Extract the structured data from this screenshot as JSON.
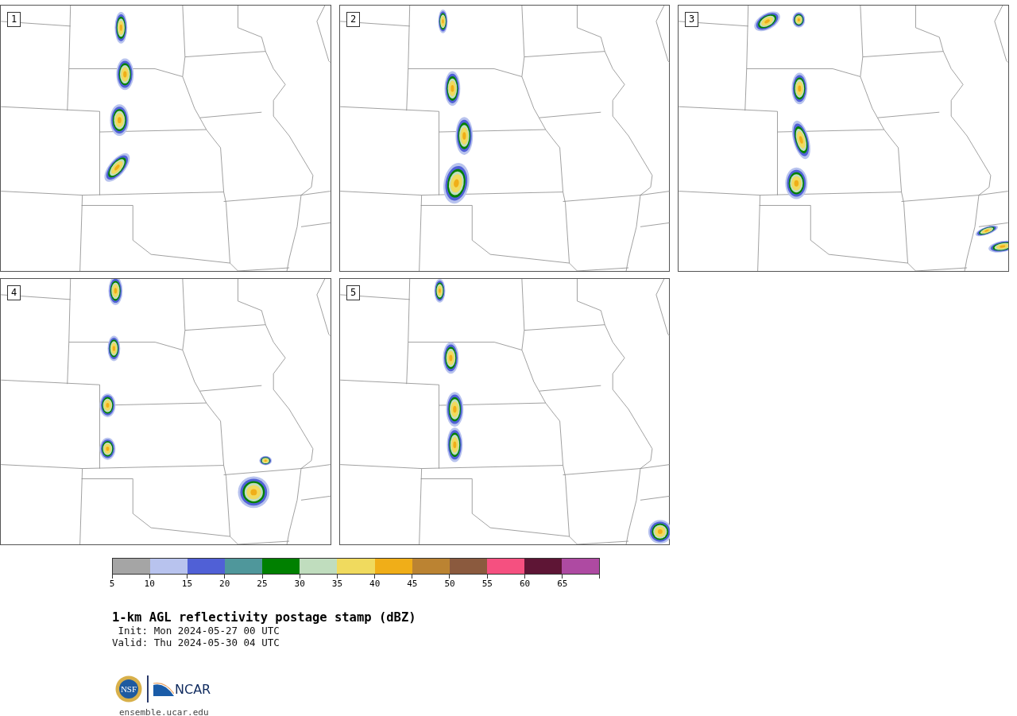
{
  "panels": [
    {
      "label": "1"
    },
    {
      "label": "2"
    },
    {
      "label": "3"
    },
    {
      "label": "4"
    },
    {
      "label": "5"
    }
  ],
  "colorbar": {
    "bins": [
      {
        "color": "#a5a5a5"
      },
      {
        "color": "#b8c3ee"
      },
      {
        "color": "#5060d6"
      },
      {
        "color": "#4f979b"
      },
      {
        "color": "#008000"
      },
      {
        "color": "#c0ddbe"
      },
      {
        "color": "#f0da5e"
      },
      {
        "color": "#f0ae18"
      },
      {
        "color": "#bb8332"
      },
      {
        "color": "#8b5a3e"
      },
      {
        "color": "#f55080"
      },
      {
        "color": "#5e1535"
      },
      {
        "color": "#ae4aa2"
      }
    ],
    "ticks": [
      "5",
      "10",
      "15",
      "20",
      "25",
      "30",
      "35",
      "40",
      "45",
      "50",
      "55",
      "60",
      "65"
    ]
  },
  "title": "1-km AGL reflectivity postage stamp (dBZ)",
  "init": "Init: Mon 2024-05-27 00 UTC",
  "valid": "Valid: Thu 2024-05-30 04 UTC",
  "logos": {
    "nsf": "NSF",
    "ncar": "NCAR"
  },
  "url": "ensemble.ucar.edu"
}
